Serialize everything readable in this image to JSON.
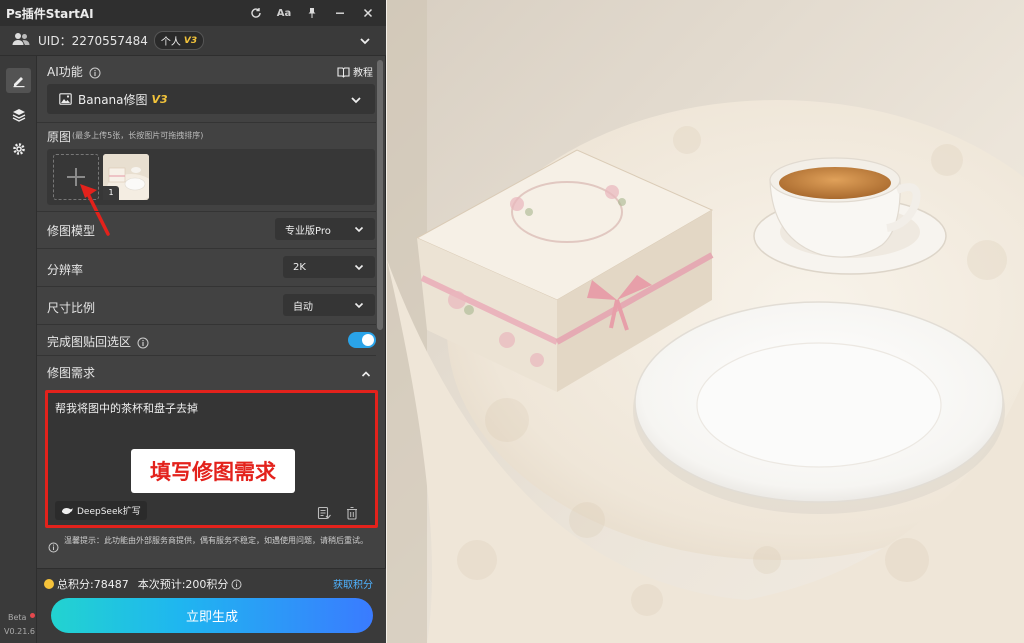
{
  "app": {
    "title": "Ps插件StartAI",
    "uid_text": "UID：2270557484",
    "badge_label": "个人",
    "badge_version": "V3"
  },
  "sidebar": {
    "beta": "Beta",
    "version": "V0.21.6"
  },
  "ai_function": {
    "label": "AI功能",
    "tutorial": "教程",
    "selected": "Banana修图",
    "selected_version": "V3"
  },
  "source_image": {
    "label": "原图",
    "hint": "(最多上传5张，长按图片可拖拽排序)",
    "thumb_index": "1"
  },
  "settings": {
    "model_label": "修图模型",
    "model_value": "专业版Pro",
    "resolution_label": "分辨率",
    "resolution_value": "2K",
    "ratio_label": "尺寸比例",
    "ratio_value": "自动",
    "paste_back_label": "完成图贴回选区",
    "paste_back_on": true
  },
  "requirement": {
    "label": "修图需求",
    "text": "帮我将图中的茶杯和盘子去掉",
    "deepseek": "DeepSeek扩写"
  },
  "annotation": {
    "callout": "填写修图需求"
  },
  "notice": {
    "text": "温馨提示：此功能由外部服务商提供，偶有服务不稳定，如遇使用问题，请稍后重试。"
  },
  "footer": {
    "total_points": "总积分:78487",
    "estimate": "本次预计:200积分",
    "get_points": "获取积分",
    "generate": "立即生成"
  },
  "colors": {
    "accent": "#2aa3e8",
    "highlight": "#e3221c",
    "version_gold": "#f2c33a"
  }
}
